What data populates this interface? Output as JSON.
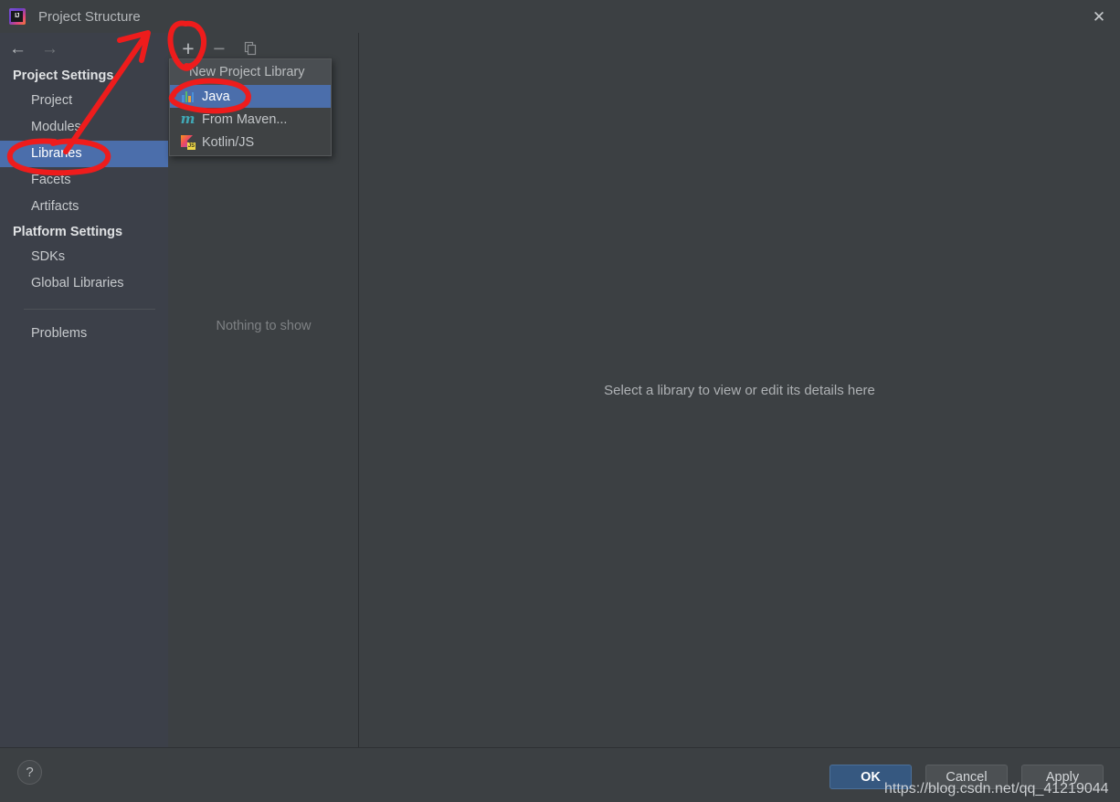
{
  "window": {
    "title": "Project Structure",
    "app_icon": "intellij-idea-icon",
    "close_icon": "close-icon"
  },
  "nav": {
    "back_icon": "arrow-left-icon",
    "forward_icon": "arrow-right-icon"
  },
  "sidebar": {
    "groups": [
      {
        "title": "Project Settings",
        "items": [
          {
            "label": "Project",
            "selected": false
          },
          {
            "label": "Modules",
            "selected": false
          },
          {
            "label": "Libraries",
            "selected": true
          },
          {
            "label": "Facets",
            "selected": false
          },
          {
            "label": "Artifacts",
            "selected": false
          }
        ]
      },
      {
        "title": "Platform Settings",
        "items": [
          {
            "label": "SDKs",
            "selected": false
          },
          {
            "label": "Global Libraries",
            "selected": false
          }
        ]
      }
    ],
    "extra_items": [
      {
        "label": "Problems",
        "selected": false
      }
    ]
  },
  "list_panel": {
    "toolbar": [
      {
        "name": "add-button",
        "icon": "plus-icon",
        "label": "+",
        "enabled": true
      },
      {
        "name": "remove-button",
        "icon": "minus-icon",
        "label": "−",
        "enabled": false
      },
      {
        "name": "copy-button",
        "icon": "copy-icon",
        "label": "",
        "enabled": false
      }
    ],
    "empty_text": "Nothing to show"
  },
  "detail_panel": {
    "hint": "Select a library to view or edit its details here"
  },
  "popup_menu": {
    "header": "New Project Library",
    "items": [
      {
        "label": "Java",
        "icon": "java-icon",
        "selected": true
      },
      {
        "label": "From Maven...",
        "icon": "maven-icon",
        "selected": false
      },
      {
        "label": "Kotlin/JS",
        "icon": "kotlin-js-icon",
        "selected": false
      }
    ]
  },
  "bottom_bar": {
    "help_icon": "question-mark-icon",
    "help_label": "?",
    "buttons": [
      {
        "label": "OK",
        "primary": true
      },
      {
        "label": "Cancel",
        "primary": false
      },
      {
        "label": "Apply",
        "primary": false
      }
    ]
  },
  "watermark": {
    "text": "https://blog.csdn.net/qq_41219044"
  },
  "colors": {
    "selection_blue": "#4b6eab",
    "primary_button": "#365880",
    "panel_bg": "#3c4043",
    "sidebar_bg": "#3c4049",
    "annotation_red": "#ee1c1c"
  }
}
